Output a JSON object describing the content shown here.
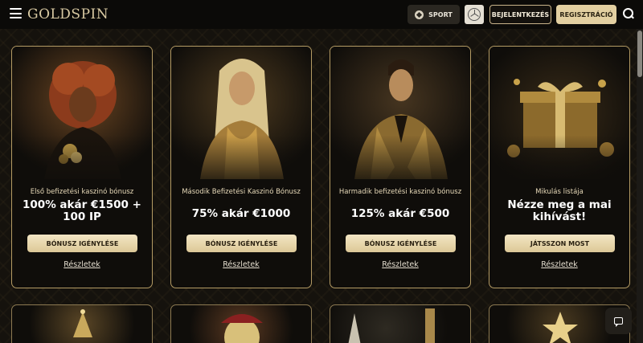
{
  "header": {
    "logo": "GOLDSPIN",
    "sport_label": "SPORT",
    "login_label": "BEJELENTKEZÉS",
    "register_label": "REGISZTRÁCIÓ",
    "icons": [
      "hamburger-menu-icon",
      "sport-ball-icon",
      "mercedes-logo",
      "search-icon"
    ]
  },
  "promos": [
    {
      "subtitle": "Első befizetési kaszinó bónusz",
      "title": "100% akár €1500 + 100 IP",
      "button": "BÓNUSZ IGÉNYLÉSE",
      "link": "Részletek",
      "image": "woman with curly red hair holding gold"
    },
    {
      "subtitle": "Második Befizetési Kaszinó Bónusz",
      "title": "75% akár €1000",
      "button": "BÓNUSZ IGÉNYLÉSE",
      "link": "Részletek",
      "image": "blonde woman in gold dress"
    },
    {
      "subtitle": "Harmadik befizetési kaszinó bónusz",
      "title": "125% akár €500",
      "button": "BÓNUSZ IGÉNYLÉSE",
      "link": "Részletek",
      "image": "man in gold suit"
    },
    {
      "subtitle": "Mikulás listája",
      "title": "Nézze meg a mai kihívást!",
      "button": "JÁTSSZON MOST",
      "link": "Részletek",
      "image": "golden gift box with christmas decorations"
    }
  ],
  "colors": {
    "accent_gold": "#e2cfa1",
    "border_gold": "#b49b64",
    "background": "#15120d"
  }
}
